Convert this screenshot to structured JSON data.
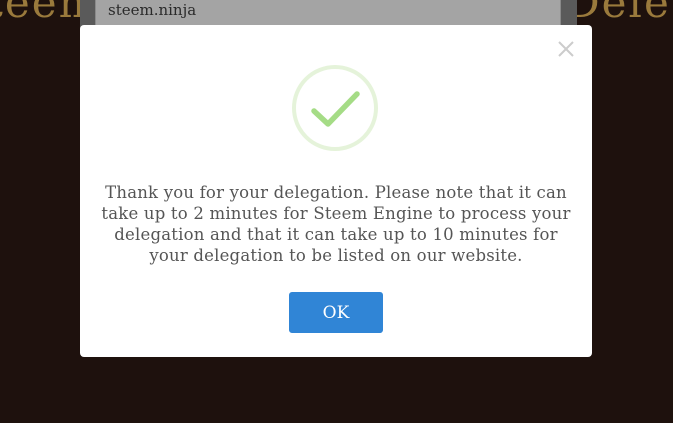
{
  "background": {
    "title_left": "teem",
    "title_right": "Deleg",
    "input_value": "steem.ninja"
  },
  "modal": {
    "close_icon": "close-icon",
    "status_icon": "success-check-icon",
    "message": "Thank you for your delegation. Please note that it can take up to 2 minutes for Steem Engine to process your delegation and that it can take up to 10 minutes for your delegation to be listed on our website.",
    "ok_label": "OK"
  },
  "colors": {
    "accent": "#3085d6",
    "success": "#a5dc86",
    "background": "#1e110d",
    "text": "#555555"
  }
}
